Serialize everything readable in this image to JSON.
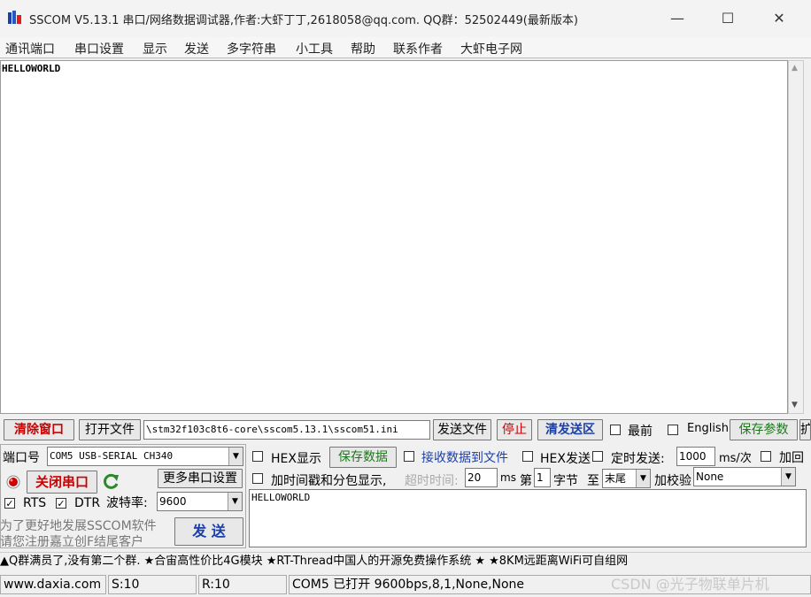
{
  "window": {
    "title": "SSCOM V5.13.1 串口/网络数据调试器,作者:大虾丁丁,2618058@qq.com. QQ群：52502449(最新版本)",
    "minimize": "—",
    "maximize": "☐",
    "close": "✕"
  },
  "menu": [
    "通讯端口",
    "串口设置",
    "显示",
    "发送",
    "多字符串",
    "小工具",
    "帮助",
    "联系作者",
    "大虾电子网"
  ],
  "receive_area": {
    "text": "HELLOWORLD",
    "scroll_up": "▲",
    "scroll_down": "▼"
  },
  "toolbar": {
    "clear_window": "清除窗口",
    "open_file": "打开文件",
    "file_path": "\\stm32f103c8t6-core\\sscom5.13.1\\sscom51.ini",
    "send_file": "发送文件",
    "stop": "停止",
    "clear_send": "清发送区",
    "topmost_label": "最前",
    "english_label": "English",
    "save_params": "保存参数",
    "more": "扩"
  },
  "port": {
    "port_label": "端口号",
    "port_value": "COM5 USB-SERIAL CH340",
    "close_port": "关闭串口",
    "more_settings": "更多串口设置",
    "rts_label": "RTS",
    "dtr_label": "DTR",
    "baud_label": "波特率:",
    "baud_value": "9600",
    "promo_line1": "为了更好地发展SSCOM软件",
    "promo_line2": "请您注册嘉立创F结尾客户",
    "send_button": "发 送"
  },
  "options": {
    "hex_display": "HEX显示",
    "save_data": "保存数据",
    "recv_to_file": "接收数据到文件",
    "hex_send": "HEX发送",
    "timed_send": "定时发送:",
    "timed_ms": "1000",
    "ms_per": "ms/次",
    "add_enter": "加回",
    "timestamp_label": "加时间戳和分包显示,",
    "timeout_label": "超时时间:",
    "timeout_value": "20",
    "ms": "ms",
    "byte_prefix": "第",
    "byte_index": "1",
    "byte_suffix": "字节",
    "to_label": "至",
    "end_value": "末尾",
    "checksum_label": "加校验",
    "checksum_value": "None"
  },
  "send_text": "HELLOWORLD",
  "ad_bar": "▲Q群满员了,没有第二个群. ★合宙高性价比4G模块 ★RT-Thread中国人的开源免费操作系统 ★ ★8KM远距离WiFi可自组网",
  "status": {
    "site": "www.daxia.com",
    "sent": "S:10",
    "received": "R:10",
    "port_status": "COM5 已打开  9600bps,8,1,None,None",
    "watermark": "CSDN @光子物联单片机"
  },
  "colors": {
    "accent_red": "#cc0000",
    "accent_blue": "#1a3fa8",
    "accent_green": "#1a7a1a"
  }
}
